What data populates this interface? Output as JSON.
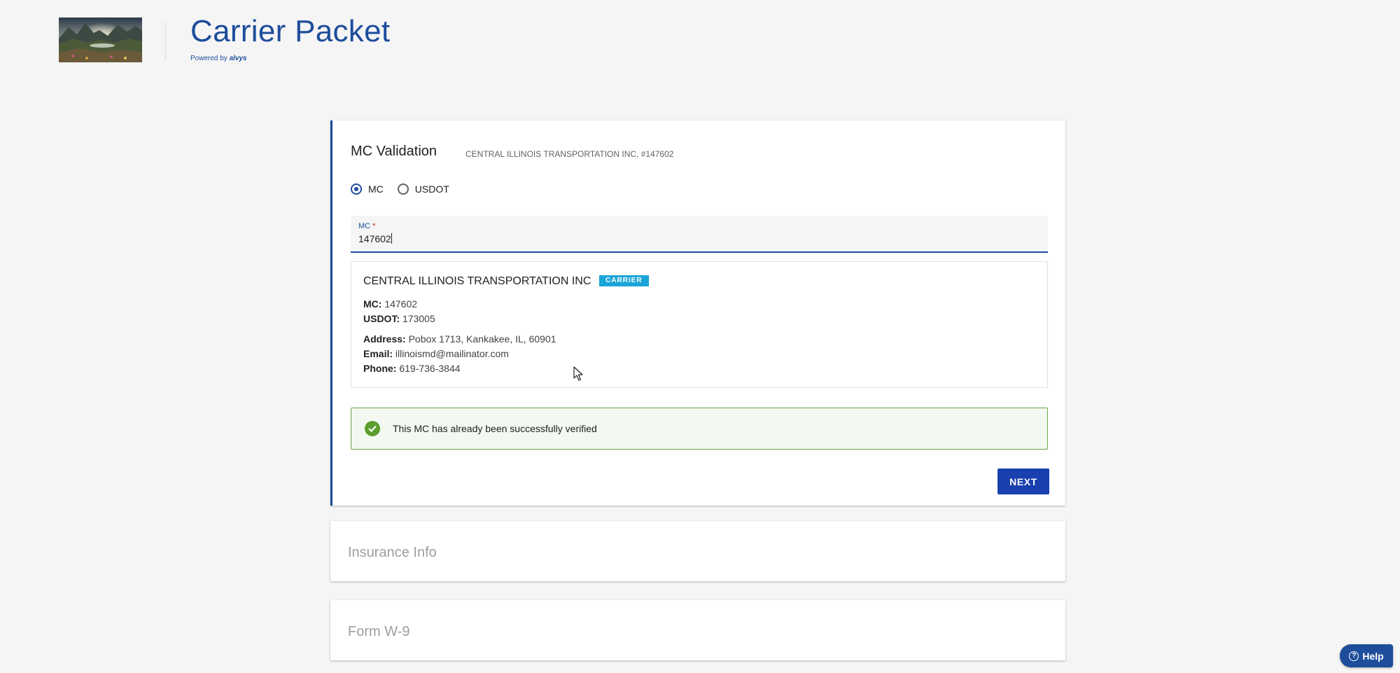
{
  "header": {
    "title": "Carrier Packet",
    "powered_prefix": "Powered by ",
    "powered_brand": "alvys"
  },
  "mc_validation": {
    "title": "MC Validation",
    "subtitle": "CENTRAL ILLINOIS TRANSPORTATION INC, #147602",
    "radio_options": [
      {
        "label": "MC",
        "checked": true
      },
      {
        "label": "USDOT",
        "checked": false
      }
    ],
    "field": {
      "label": "MC",
      "required_marker": "*",
      "value": "147602"
    },
    "carrier": {
      "name": "CENTRAL ILLINOIS TRANSPORTATION INC",
      "badge": "CARRIER",
      "mc_label": "MC:",
      "mc_value": "147602",
      "usdot_label": "USDOT:",
      "usdot_value": "173005",
      "address_label": "Address:",
      "address_value": "Pobox 1713, Kankakee, IL, 60901",
      "email_label": "Email:",
      "email_value": "illinoismd@mailinator.com",
      "phone_label": "Phone:",
      "phone_value": "619-736-3844"
    },
    "alert_text": "This MC has already been successfully verified",
    "next_label": "NEXT"
  },
  "sections": {
    "insurance_title": "Insurance Info",
    "w9_title": "Form W-9"
  },
  "help": {
    "label": "Help",
    "icon": "help-circle-icon"
  },
  "colors": {
    "primary": "#1d4d9b",
    "button": "#1a40b0",
    "badge": "#1ba5d8",
    "success_border": "#6aa744",
    "success_bg": "#f3f8f0",
    "success_icon": "#5c9e2c"
  }
}
